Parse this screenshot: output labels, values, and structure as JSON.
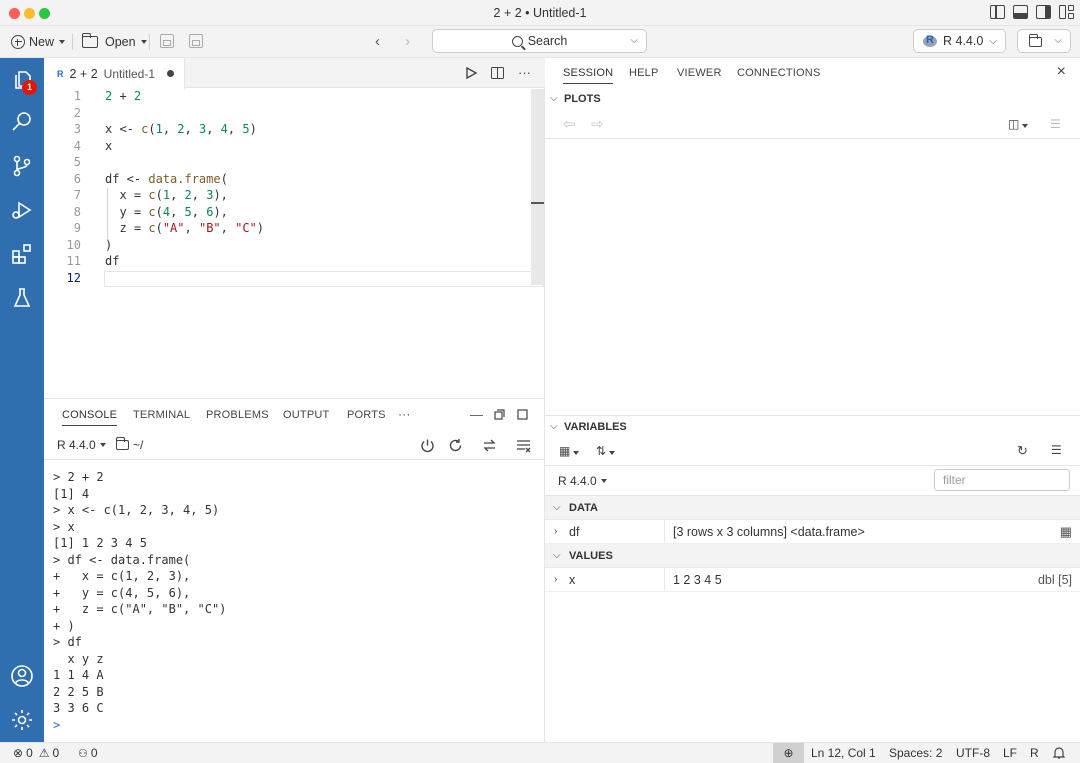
{
  "window": {
    "title": "2 + 2 • Untitled-1"
  },
  "toolbar": {
    "new_label": "New",
    "open_label": "Open",
    "search_label": "Search",
    "r_version": "R 4.4.0"
  },
  "editor": {
    "tab": {
      "icon": "R",
      "name": "2 + 2",
      "file": "Untitled-1"
    },
    "line_numbers": [
      "1",
      "2",
      "3",
      "4",
      "5",
      "6",
      "7",
      "8",
      "9",
      "10",
      "11",
      "12"
    ],
    "active_line": "12",
    "lines": [
      "2 + 2",
      "",
      "x <- c(1, 2, 3, 4, 5)",
      "x",
      "",
      "df <- data.frame(",
      "  x = c(1, 2, 3),",
      "  y = c(4, 5, 6),",
      "  z = c(\"A\", \"B\", \"C\")",
      ")",
      "df",
      ""
    ]
  },
  "panel": {
    "tabs": [
      "CONSOLE",
      "TERMINAL",
      "PROBLEMS",
      "OUTPUT",
      "PORTS",
      "···"
    ],
    "r_version": "R 4.4.0",
    "working_dir": "~/",
    "console_lines": [
      "> 2 + 2",
      "[1] 4",
      "> x <- c(1, 2, 3, 4, 5)",
      "> x",
      "[1] 1 2 3 4 5",
      "> df <- data.frame(",
      "+   x = c(1, 2, 3),",
      "+   y = c(4, 5, 6),",
      "+   z = c(\"A\", \"B\", \"C\")",
      "+ )",
      "> df",
      "  x y z",
      "1 1 4 A",
      "2 2 5 B",
      "3 3 6 C",
      ">"
    ]
  },
  "right": {
    "tabs": [
      "SESSION",
      "HELP",
      "VIEWER",
      "CONNECTIONS"
    ],
    "plots_title": "PLOTS",
    "variables_title": "VARIABLES",
    "r_version": "R 4.4.0",
    "filter_placeholder": "filter",
    "data_group": "DATA",
    "values_group": "VALUES",
    "data_rows": [
      {
        "name": "df",
        "value": "[3 rows x 3 columns] <data.frame>"
      }
    ],
    "value_rows": [
      {
        "name": "x",
        "value": "1 2 3 4 5",
        "type": "dbl [5]"
      }
    ]
  },
  "status": {
    "errors": "0",
    "warnings": "0",
    "ports": "0",
    "position": "Ln 12, Col 1",
    "spaces": "Spaces: 2",
    "encoding": "UTF-8",
    "eol": "LF",
    "language": "R"
  },
  "activity": {
    "badge": "1"
  },
  "colors": {
    "activity_bar": "#2f6fb0",
    "number": "#098658",
    "string": "#a31515",
    "function": "#795e26",
    "badge": "#e51400"
  }
}
